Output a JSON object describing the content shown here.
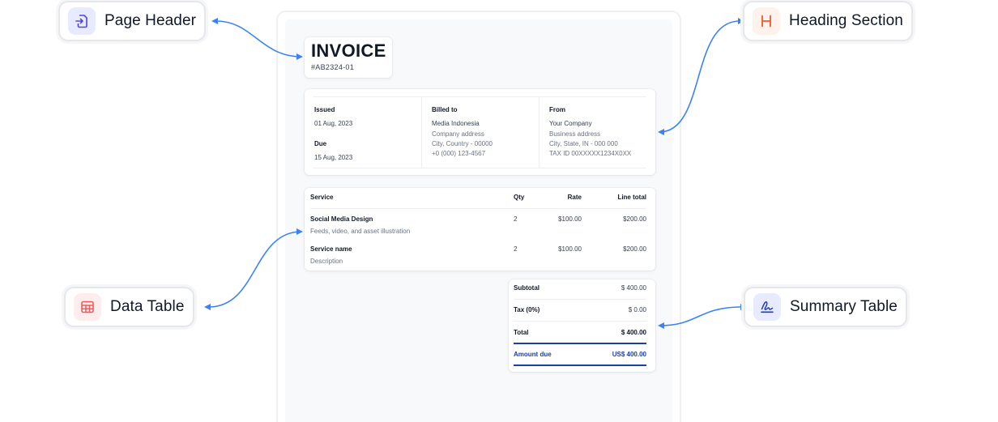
{
  "callouts": {
    "page_header": {
      "label": "Page Header",
      "icon": "file-import-icon",
      "icon_bg": "#e8ebff",
      "icon_color": "#4f46e5"
    },
    "heading_section": {
      "label": "Heading Section",
      "icon": "heading-h-icon",
      "icon_bg": "#fff1eb",
      "icon_color": "#f0592a"
    },
    "data_table": {
      "label": "Data Table",
      "icon": "table-grid-icon",
      "icon_bg": "#ffecec",
      "icon_color": "#ef5b5b"
    },
    "summary_table": {
      "label": "Summary Table",
      "icon": "signature-icon",
      "icon_bg": "#e8ebff",
      "icon_color": "#1f3fae"
    }
  },
  "connector_color": "#3b82f6",
  "invoice": {
    "title": "INVOICE",
    "number": "#AB2324-01",
    "issued_label": "Issued",
    "issued_date": "01 Aug, 2023",
    "due_label": "Due",
    "due_date": "15 Aug, 2023",
    "billed_to": {
      "label": "Billed to",
      "name": "Media Indonesia",
      "address": "Company address",
      "city": "City, Country - 00000",
      "phone": "+0 (000) 123-4567"
    },
    "from": {
      "label": "From",
      "name": "Your Company",
      "address": "Business address",
      "city": "City, State, IN - 000 000",
      "tax": "TAX ID 00XXXXX1234X0XX"
    },
    "table": {
      "headers": [
        "Service",
        "Qty",
        "Rate",
        "Line total"
      ],
      "rows": [
        {
          "service": "Social Media Design",
          "description": "Feeds, video, and asset illustration",
          "qty": "2",
          "rate": "$100.00",
          "total": "$200.00"
        },
        {
          "service": "Service name",
          "description": "Description",
          "qty": "2",
          "rate": "$100.00",
          "total": "$200.00"
        }
      ]
    },
    "summary": {
      "subtotal_label": "Subtotal",
      "subtotal": "$ 400.00",
      "tax_label": "Tax (0%)",
      "tax": "$ 0.00",
      "total_label": "Total",
      "total": "$ 400.00",
      "amount_due_label": "Amount due",
      "amount_due": "US$ 400.00"
    },
    "accent": "#1d3fa8"
  }
}
